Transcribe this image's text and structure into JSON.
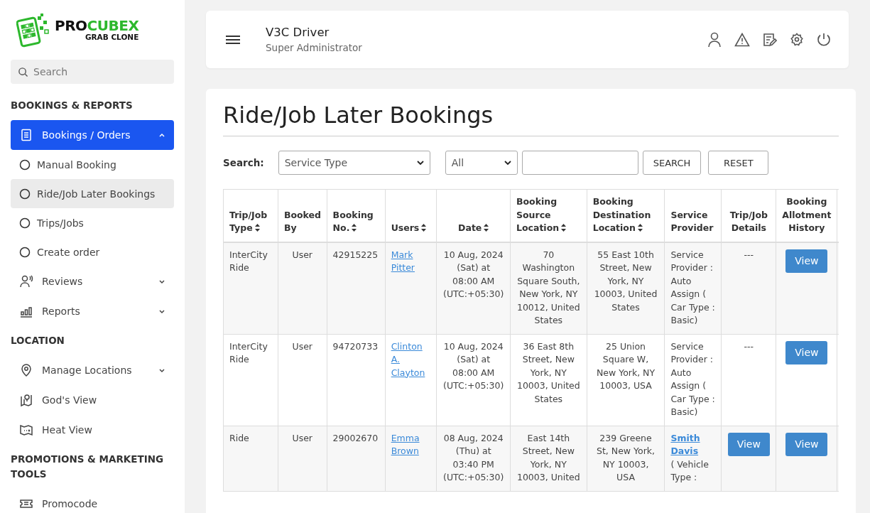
{
  "logo": {
    "brand_dark": "PRO",
    "brand_accent": "CUBEX",
    "tagline": "GRAB CLONE"
  },
  "sidebar": {
    "search": {
      "placeholder": "Search"
    },
    "sections": [
      {
        "title": "BOOKINGS & REPORTS",
        "items": [
          {
            "label": "Bookings / Orders",
            "kind": "document",
            "selected": true,
            "expanded": true,
            "children": [
              {
                "label": "Manual Booking",
                "selected": false
              },
              {
                "label": "Ride/Job Later Bookings",
                "selected": true
              },
              {
                "label": "Trips/Jobs",
                "selected": false
              },
              {
                "label": "Create order",
                "selected": false
              }
            ]
          },
          {
            "label": "Reviews",
            "kind": "reviewer",
            "selected": false,
            "expanded": false
          },
          {
            "label": "Reports",
            "kind": "chart",
            "selected": false,
            "expanded": false
          }
        ]
      },
      {
        "title": "LOCATION",
        "items": [
          {
            "label": "Manage Locations",
            "kind": "pin",
            "selected": false,
            "expanded": false
          },
          {
            "label": "God's View",
            "kind": "mappin",
            "selected": false
          },
          {
            "label": "Heat View",
            "kind": "map",
            "selected": false
          }
        ]
      },
      {
        "title": "PROMOTIONS & MARKETING TOOLS",
        "items": [
          {
            "label": "Promocode",
            "kind": "ticket",
            "selected": false
          }
        ]
      }
    ]
  },
  "header": {
    "title": "V3C Driver",
    "subtitle": "Super Administrator"
  },
  "page": {
    "title": "Ride/Job Later Bookings",
    "search": {
      "label": "Search:",
      "service_type": "Service Type",
      "filter": "All",
      "buttons": [
        "SEARCH",
        "RESET"
      ]
    },
    "table": {
      "columns": [
        {
          "label": "Trip/Job Type",
          "sortable": true
        },
        {
          "label": "Booked By",
          "sortable": false
        },
        {
          "label": "Booking No.",
          "sortable": true
        },
        {
          "label": "Users",
          "sortable": true
        },
        {
          "label": "Date",
          "sortable": true
        },
        {
          "label": "Booking Source Location",
          "sortable": true
        },
        {
          "label": "Booking Destination Location",
          "sortable": true
        },
        {
          "label": "Service Provider",
          "sortable": false
        },
        {
          "label": "Trip/Job Details",
          "sortable": false
        },
        {
          "label": "Booking Allotment History",
          "sortable": false
        }
      ],
      "rows": [
        {
          "type": "InterCity Ride",
          "booked_by": "User",
          "booking_no": "42915225",
          "user": "Mark Pitter",
          "date": "10 Aug, 2024 (Sat) at 08:00 AM (UTC:+05:30)",
          "source": "70 Washington Square South, New York, NY 10012, United States",
          "destination": "55 East 10th Street, New York, NY 10003, United States",
          "provider": {
            "text": "Service Provider : Auto Assign ( Car Type : Basic)"
          },
          "details": {
            "kind": "text",
            "label": "---"
          },
          "allotment": "View"
        },
        {
          "type": "InterCity Ride",
          "booked_by": "User",
          "booking_no": "94720733",
          "user": "Clinton A. Clayton",
          "date": "10 Aug, 2024 (Sat) at 08:00 AM (UTC:+05:30)",
          "source": "36 East 8th Street, New York, NY 10003, United States",
          "destination": "25 Union Square W, New York, NY 10003, USA",
          "provider": {
            "text": "Service Provider : Auto Assign ( Car Type : Basic)"
          },
          "details": {
            "kind": "text",
            "label": "---"
          },
          "allotment": "View"
        },
        {
          "type": "Ride",
          "booked_by": "User",
          "booking_no": "29002670",
          "user": "Emma Brown",
          "date": "08 Aug, 2024 (Thu) at 03:40 PM (UTC:+05:30)",
          "source": "East 14th Street, New York, NY 10003, United",
          "destination": "239 Greene St, New York, NY 10003, USA",
          "provider": {
            "link": "Smith Davis",
            "text": "( Vehicle Type :"
          },
          "details": {
            "kind": "button",
            "label": "View"
          },
          "allotment": "View"
        }
      ]
    }
  }
}
